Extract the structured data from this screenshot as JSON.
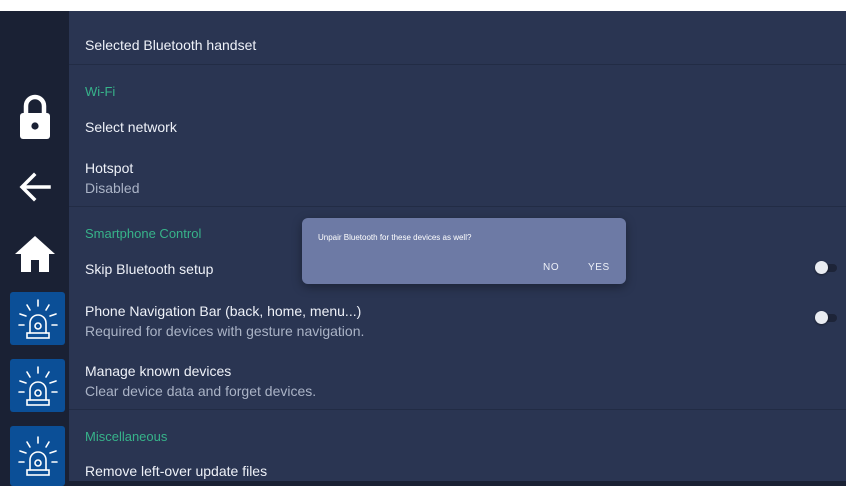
{
  "sidebar": {
    "lock_icon": "lock-icon",
    "back_icon": "back-arrow-icon",
    "home_icon": "home-icon",
    "alarm_icon": "alarm-light-icon"
  },
  "settings": {
    "faded_label": "",
    "selected_handset": "Selected Bluetooth handset",
    "wifi": {
      "header": "Wi-Fi",
      "select_network": "Select network",
      "hotspot_title": "Hotspot",
      "hotspot_status": "Disabled"
    },
    "smartphone": {
      "header": "Smartphone Control",
      "skip_bluetooth": "Skip Bluetooth setup",
      "nav_bar_title": "Phone Navigation Bar (back, home, menu...)",
      "nav_bar_sub": "Required for devices with gesture navigation.",
      "manage_title": "Manage known devices",
      "manage_sub": "Clear device data and forget devices."
    },
    "misc": {
      "header": "Miscellaneous",
      "remove_files": "Remove left-over update files"
    }
  },
  "dialog": {
    "message": "Unpair Bluetooth for these devices as well?",
    "no_label": "NO",
    "yes_label": "YES"
  },
  "colors": {
    "accent_green": "#37b38a",
    "sidebar_tile": "#0b4f97",
    "background": "#2a3552",
    "dialog": "#6d7aa5"
  }
}
